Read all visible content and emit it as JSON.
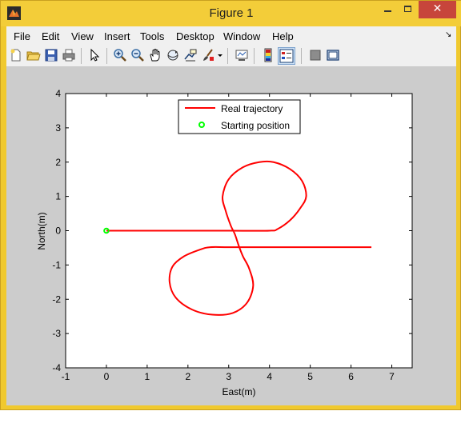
{
  "window": {
    "title": "Figure 1",
    "close_glyph": "✕"
  },
  "menu": {
    "items": [
      "File",
      "Edit",
      "View",
      "Insert",
      "Tools",
      "Desktop",
      "Window",
      "Help"
    ],
    "dock_arrow": "↘"
  },
  "toolbar": {
    "icons": [
      "new-figure-icon",
      "open-file-icon",
      "save-figure-icon",
      "print-figure-icon",
      "edit-plot-arrow-icon",
      "zoom-in-icon",
      "zoom-out-icon",
      "pan-hand-icon",
      "rotate-3d-icon",
      "data-cursor-icon",
      "brush-icon",
      "brush-dropdown-icon",
      "link-plot-icon",
      "insert-colorbar-icon",
      "insert-legend-icon",
      "hide-plot-tools-icon",
      "show-plot-tools-icon"
    ],
    "active": "insert-legend-icon"
  },
  "colors": {
    "trajectory": "#ff0000",
    "start_marker": "#00ff00",
    "figure_bg": "#cccccc"
  },
  "chart_data": {
    "type": "line",
    "xlabel": "East(m)",
    "ylabel": "North(m)",
    "xlim": [
      -1,
      7.5
    ],
    "ylim": [
      -4,
      4
    ],
    "xticks": [
      -1,
      0,
      1,
      2,
      3,
      4,
      5,
      6,
      7
    ],
    "yticks": [
      -4,
      -3,
      -2,
      -1,
      0,
      1,
      2,
      3,
      4
    ],
    "grid": false,
    "legend_position": "top",
    "series": [
      {
        "name": "Real trajectory",
        "style": "line",
        "color": "#ff0000",
        "x": [
          0,
          1,
          2,
          3,
          4,
          4.2,
          4.5,
          4.75,
          4.9,
          4.8,
          4.5,
          4.1,
          3.75,
          3.35,
          3.0,
          2.85,
          2.92,
          3.05,
          3.15,
          3.25,
          3.35,
          3.5,
          3.6,
          3.45,
          3.1,
          2.6,
          2.1,
          1.7,
          1.55,
          1.62,
          1.9,
          2.3,
          2.55,
          3,
          4,
          5,
          6,
          6.5
        ],
        "y": [
          0,
          0,
          0,
          0,
          0,
          0.05,
          0.3,
          0.65,
          1.0,
          1.45,
          1.8,
          2.0,
          2.0,
          1.85,
          1.5,
          1.0,
          0.6,
          0.15,
          -0.1,
          -0.45,
          -0.75,
          -1.1,
          -1.6,
          -2.1,
          -2.4,
          -2.45,
          -2.3,
          -1.95,
          -1.5,
          -1.05,
          -0.75,
          -0.55,
          -0.48,
          -0.48,
          -0.48,
          -0.48,
          -0.48,
          -0.48
        ]
      },
      {
        "name": "Starting position",
        "style": "marker",
        "color": "#00ff00",
        "x": [
          0
        ],
        "y": [
          0
        ]
      }
    ]
  }
}
